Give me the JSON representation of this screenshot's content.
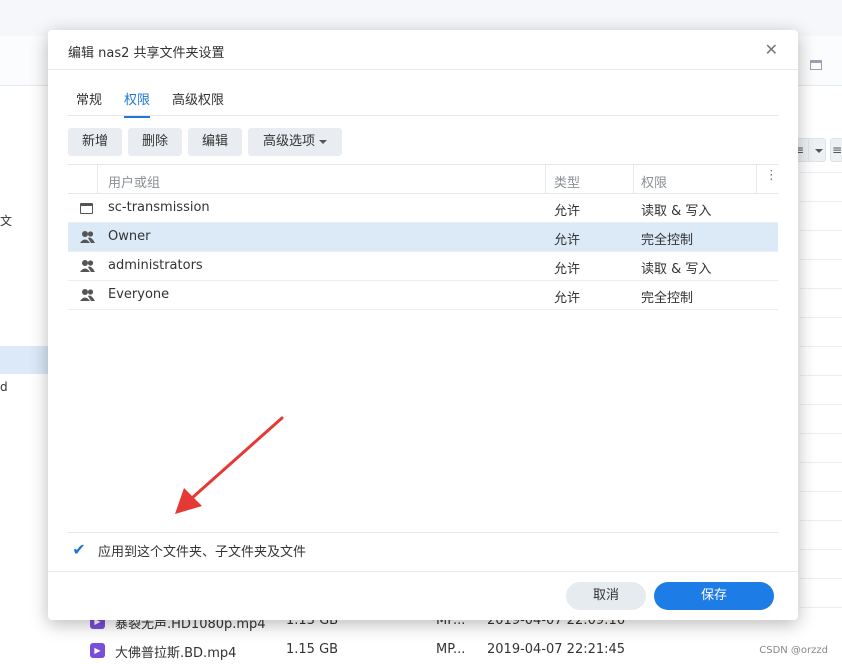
{
  "background": {
    "sidebar_partial": [
      "文",
      "d"
    ],
    "files": [
      {
        "name": "暴裂无声.HD1080p.mp4",
        "size": "1.13 GB",
        "type": "MP...",
        "modified": "2019-04-07 22:09:16"
      },
      {
        "name": "大佛普拉斯.BD.mp4",
        "size": "1.15 GB",
        "type": "MP...",
        "modified": "2019-04-07 22:21:45"
      }
    ],
    "watermark": "CSDN @orzzd"
  },
  "dialog": {
    "title": "编辑 nas2 共享文件夹设置",
    "close_glyph": "✕",
    "tabs": [
      {
        "label": "常规",
        "active": false
      },
      {
        "label": "权限",
        "active": true
      },
      {
        "label": "高级权限",
        "active": false
      }
    ],
    "toolbar": {
      "add": "新增",
      "delete": "删除",
      "edit": "编辑",
      "advanced": "高级选项"
    },
    "columns": {
      "user_or_group": "用户或组",
      "type": "类型",
      "permission": "权限",
      "menu_glyph": "⋮"
    },
    "rows": [
      {
        "name": "sc-transmission",
        "icon": "app-window-icon",
        "type": "允许",
        "permission": "读取 & 写入",
        "selected": false
      },
      {
        "name": "Owner",
        "icon": "group-icon",
        "type": "允许",
        "permission": "完全控制",
        "selected": true
      },
      {
        "name": "administrators",
        "icon": "group-icon",
        "type": "允许",
        "permission": "读取 & 写入",
        "selected": false
      },
      {
        "name": "Everyone",
        "icon": "group-icon",
        "type": "允许",
        "permission": "完全控制",
        "selected": false
      }
    ],
    "apply_checkbox": {
      "checked": true,
      "glyph": "✔",
      "label": "应用到这个文件夹、子文件夹及文件"
    },
    "footer": {
      "cancel": "取消",
      "save": "保存"
    }
  },
  "colors": {
    "accent": "#1e7ce6",
    "selected_row": "#dce9f7",
    "annotation_arrow": "#e53935"
  }
}
